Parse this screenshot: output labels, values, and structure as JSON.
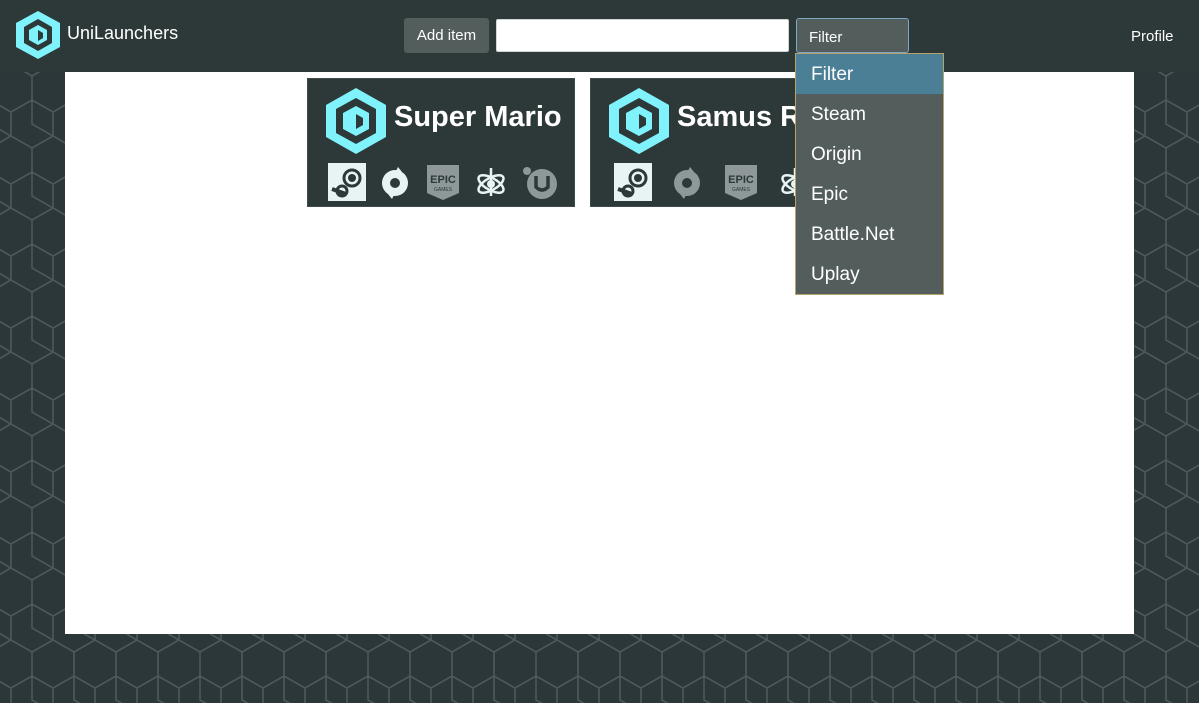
{
  "app": {
    "name": "UniLaunchers",
    "colors": {
      "accent": "#7ff2fc",
      "bg": "#2d3939",
      "highlight": "#4b7f96"
    }
  },
  "header": {
    "add_item_label": "Add item",
    "search_value": "",
    "filter_selected": "Filter",
    "profile_label": "Profile"
  },
  "filter_options": [
    "Filter",
    "Steam",
    "Origin",
    "Epic",
    "Battle.Net",
    "Uplay"
  ],
  "games": [
    {
      "title": "Super Mario",
      "icon": "unilaunchers-cube-icon",
      "launchers": [
        {
          "name": "steam-icon",
          "active": true
        },
        {
          "name": "origin-icon",
          "active": true
        },
        {
          "name": "epic-games-icon",
          "active": false
        },
        {
          "name": "battle-net-icon",
          "active": true
        },
        {
          "name": "uplay-icon",
          "active": false
        }
      ]
    },
    {
      "title": "Samus Ro",
      "icon": "unilaunchers-cube-icon",
      "launchers": [
        {
          "name": "steam-icon",
          "active": true
        },
        {
          "name": "origin-icon",
          "active": false
        },
        {
          "name": "epic-games-icon",
          "active": false
        },
        {
          "name": "battle-net-icon",
          "active": true
        }
      ]
    }
  ]
}
